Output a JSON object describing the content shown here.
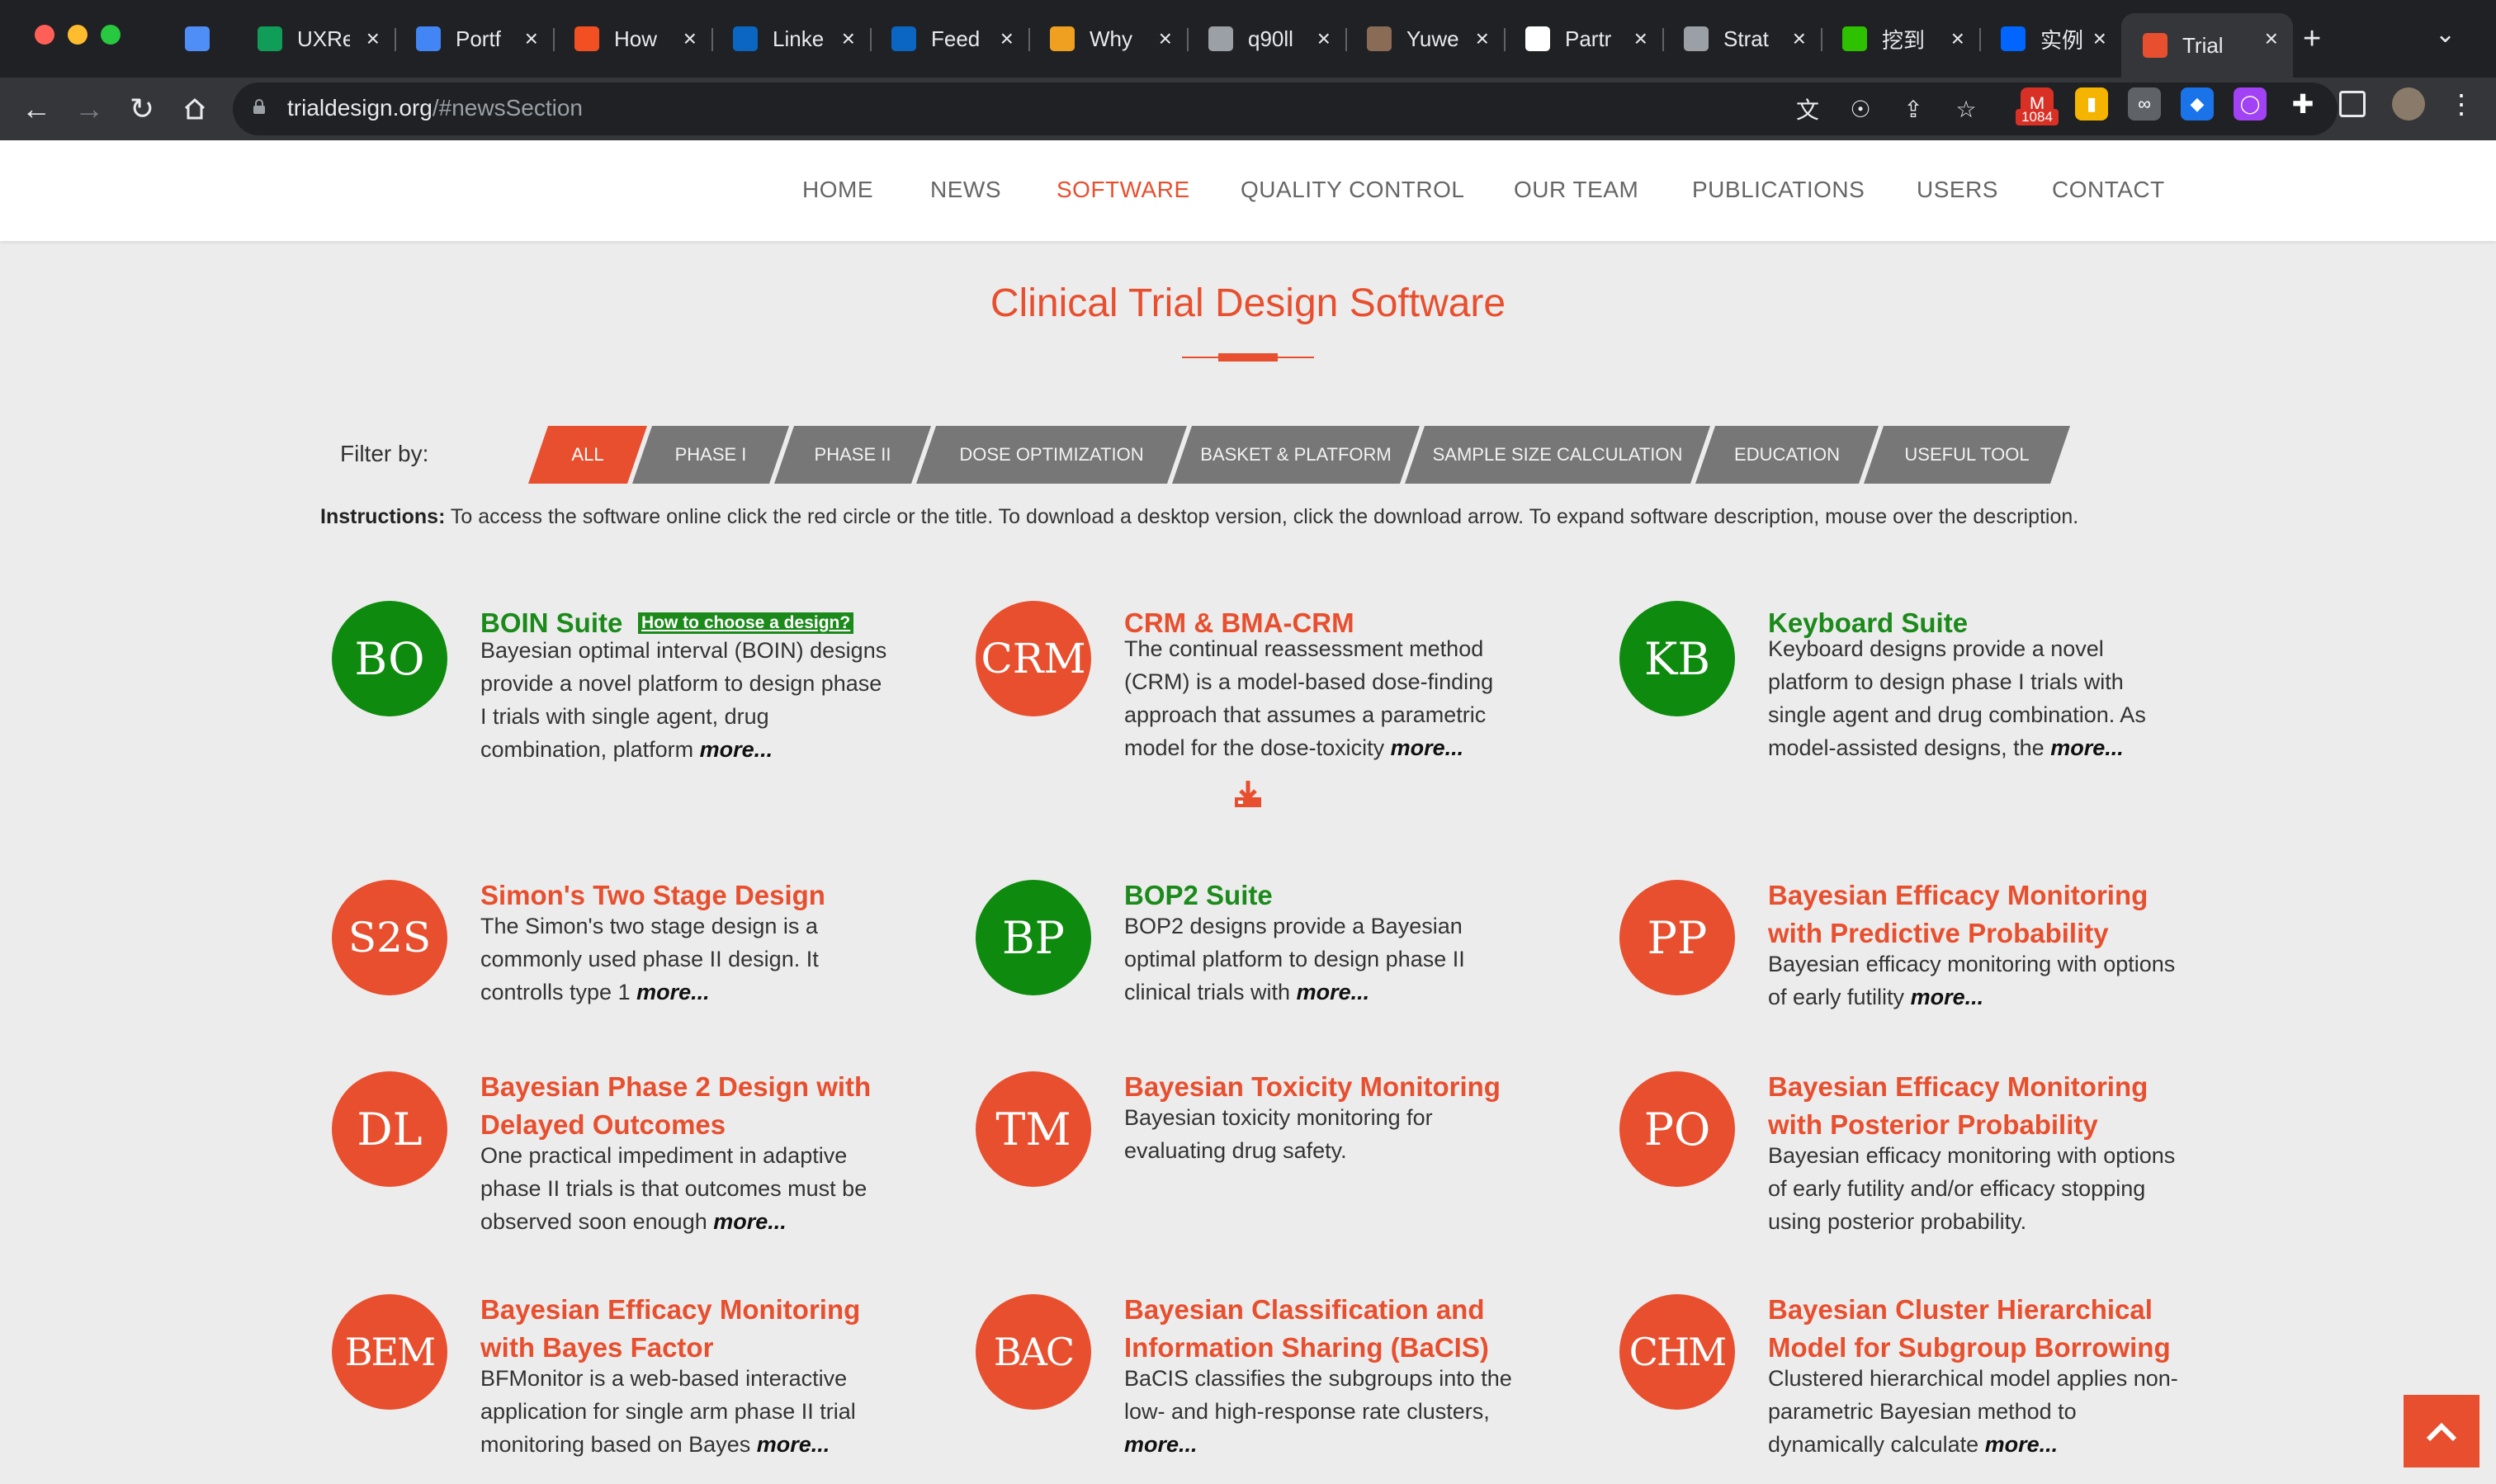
{
  "browser": {
    "tabs": [
      {
        "label": "",
        "icon": "gem-icon",
        "color": "#4f8df7"
      },
      {
        "label": "UXRe",
        "icon": "sheets-icon",
        "color": "#0f9d58"
      },
      {
        "label": "Portf",
        "icon": "docs-icon",
        "color": "#4285f4"
      },
      {
        "label": "How",
        "icon": "microsoft-icon",
        "color": "#f25022"
      },
      {
        "label": "Linke",
        "icon": "linkedin-icon",
        "color": "#0a66c2"
      },
      {
        "label": "Feed",
        "icon": "linkedin-icon",
        "color": "#0a66c2"
      },
      {
        "label": "Why",
        "icon": "vue-icon",
        "color": "#f0a020"
      },
      {
        "label": "q90ll",
        "icon": "doc-icon",
        "color": "#9aa0a6"
      },
      {
        "label": "Yuwe",
        "icon": "photo-icon",
        "color": "#8a6b55"
      },
      {
        "label": "Partr",
        "icon": "a-icon",
        "color": "#ffffff"
      },
      {
        "label": "Strat",
        "icon": "globe-icon",
        "color": "#9aa0a6"
      },
      {
        "label": "挖到",
        "icon": "wechat-icon",
        "color": "#2dc100"
      },
      {
        "label": "实例",
        "icon": "zhihu-icon",
        "color": "#0066ff"
      },
      {
        "label": "Trial",
        "icon": "trial-icon",
        "color": "#e84f2e"
      }
    ],
    "url_host": "trialdesign.org",
    "url_path": "/#newsSection",
    "mail_badge": "1084"
  },
  "nav": {
    "items": [
      "HOME",
      "NEWS",
      "SOFTWARE",
      "QUALITY CONTROL",
      "OUR TEAM",
      "PUBLICATIONS",
      "USERS",
      "CONTACT"
    ],
    "active": "SOFTWARE"
  },
  "page_title": "Clinical Trial Design Software",
  "filter": {
    "label": "Filter by:",
    "options": [
      "ALL",
      "PHASE I",
      "PHASE II",
      "DOSE OPTIMIZATION",
      "BASKET & PLATFORM",
      "SAMPLE SIZE CALCULATION",
      "EDUCATION",
      "USEFUL TOOL"
    ],
    "active": "ALL"
  },
  "instructions": {
    "bold": "Instructions:",
    "text": " To access the software online click the red circle or the title. To download a desktop version, click the download arrow. To expand software description, mouse over the description."
  },
  "colors": {
    "accent": "#e84f2e",
    "green": "#1b8a1b"
  },
  "cards": [
    {
      "abbr": "BO",
      "title": "BOIN Suite",
      "desc": "Bayesian optimal interval (BOIN) designs provide a novel platform to design phase I trials with single agent, drug combination, platform",
      "more": "more...",
      "color": "#0e8a0e",
      "extra_link": "How to choose a design?"
    },
    {
      "abbr": "CRM",
      "title": "CRM & BMA-CRM",
      "desc": "The continual reassessment method (CRM) is a model-based dose-finding approach that assumes a parametric model for the dose-toxicity",
      "more": "more...",
      "color": "#e84f2e"
    },
    {
      "abbr": "KB",
      "title": "Keyboard Suite",
      "desc": "Keyboard designs provide a novel platform to design phase I trials with single agent and drug combination. As model-assisted designs, the",
      "more": "more...",
      "color": "#0e8a0e"
    },
    {
      "abbr": "S2S",
      "title": "Simon's Two Stage Design",
      "desc": "The Simon's two stage design is a commonly used phase II design. It controlls type 1",
      "more": "more...",
      "color": "#e84f2e"
    },
    {
      "abbr": "BP",
      "title": "BOP2 Suite",
      "desc": "BOP2 designs provide a Bayesian optimal platform to design phase II clinical trials with",
      "more": "more...",
      "color": "#0e8a0e"
    },
    {
      "abbr": "PP",
      "title": "Bayesian Efficacy Monitoring with Predictive Probability",
      "desc": "Bayesian efficacy monitoring with options of early futility",
      "more": "more...",
      "color": "#e84f2e"
    },
    {
      "abbr": "DL",
      "title": "Bayesian Phase 2 Design with Delayed Outcomes",
      "desc": "One practical impediment in adaptive phase II trials is that outcomes must be observed soon enough",
      "more": "more...",
      "color": "#e84f2e"
    },
    {
      "abbr": "TM",
      "title": "Bayesian Toxicity Monitoring",
      "desc": "Bayesian toxicity monitoring for evaluating drug safety.",
      "more": "",
      "color": "#e84f2e"
    },
    {
      "abbr": "PO",
      "title": "Bayesian Efficacy Monitoring with Posterior Probability",
      "desc": "Bayesian efficacy monitoring with options of early futility and/or efficacy stopping using posterior probability.",
      "more": "",
      "color": "#e84f2e"
    },
    {
      "abbr": "BEM",
      "title": "Bayesian Efficacy Monitoring with Bayes Factor",
      "desc": "BFMonitor is a web-based interactive application for single arm phase II trial monitoring based on Bayes",
      "more": "more...",
      "color": "#e84f2e"
    },
    {
      "abbr": "BAC",
      "title": "Bayesian Classification and Information Sharing (BaCIS)",
      "desc": "BaCIS classifies the subgroups into the low- and high-response rate clusters,",
      "more": "more...",
      "color": "#e84f2e"
    },
    {
      "abbr": "CHM",
      "title": "Bayesian Cluster Hierarchical Model for Subgroup Borrowing",
      "desc": "Clustered hierarchical model applies non-parametric Bayesian method to dynamically calculate",
      "more": "more...",
      "color": "#e84f2e"
    }
  ]
}
